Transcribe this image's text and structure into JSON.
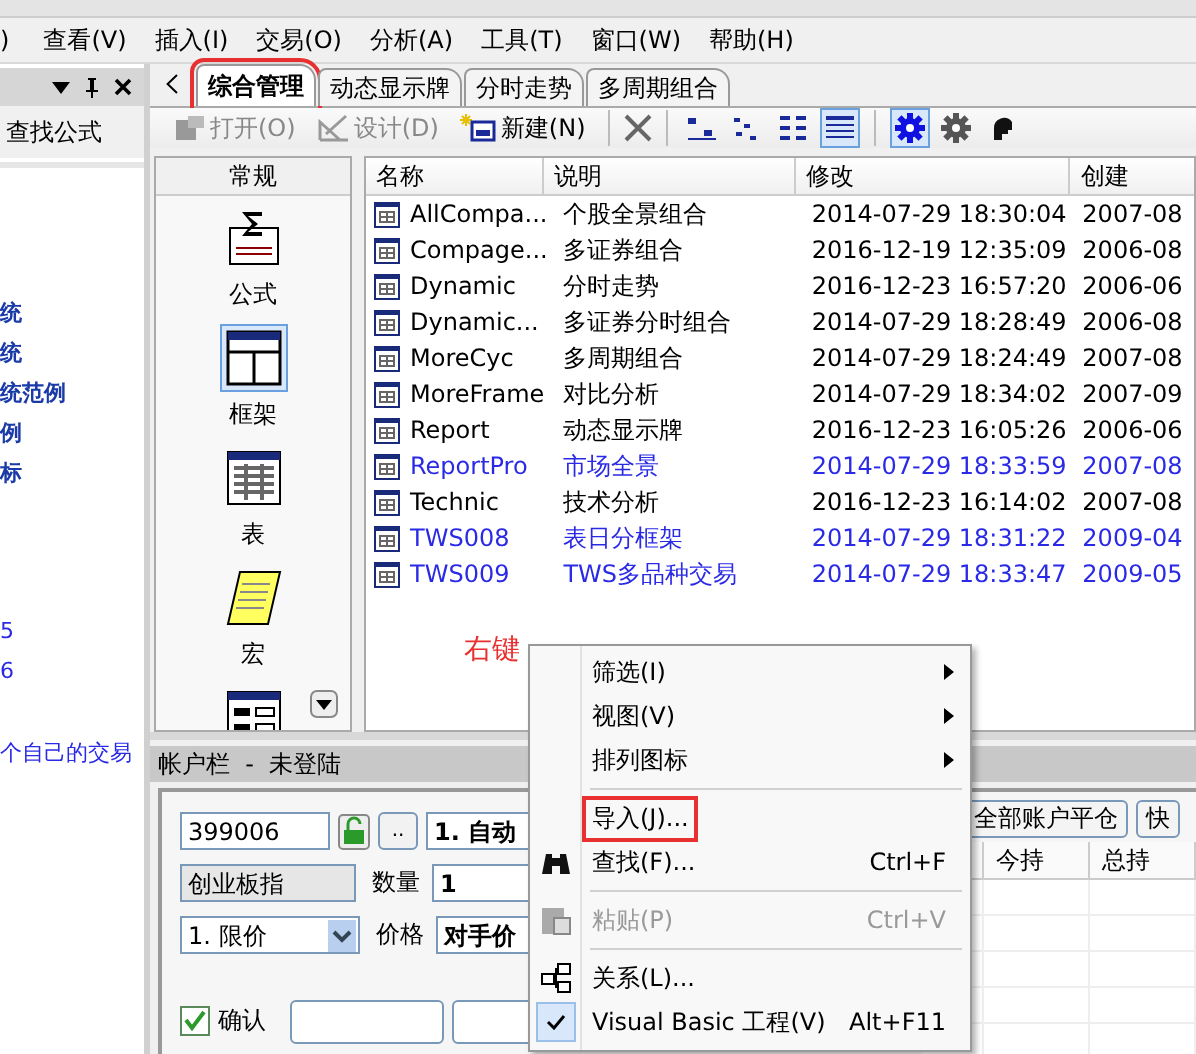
{
  "menu_bar": [
    {
      "label": ")"
    },
    {
      "label": "查看(V)"
    },
    {
      "label": "插入(I)"
    },
    {
      "label": "交易(O)"
    },
    {
      "label": "分析(A)"
    },
    {
      "label": "工具(T)"
    },
    {
      "label": "窗口(W)"
    },
    {
      "label": "帮助(H)"
    }
  ],
  "left_panel": {
    "search_label": "查找公式",
    "items": [
      "统",
      "统",
      "统范例",
      "例",
      "标",
      "5",
      "6",
      "个自己的交易"
    ]
  },
  "tabs": [
    {
      "label": "综合管理",
      "selected": true,
      "annotated": true
    },
    {
      "label": "动态显示牌",
      "selected": false,
      "annotated": false
    },
    {
      "label": "分时走势",
      "selected": false,
      "annotated": false
    },
    {
      "label": "多周期组合",
      "selected": false,
      "annotated": false
    }
  ],
  "toolbar": {
    "buttons": [
      {
        "label": "打开(O)",
        "disabled": true
      },
      {
        "label": "设计(D)",
        "disabled": true
      },
      {
        "label": "新建(N)",
        "disabled": false
      }
    ],
    "view_buttons": [
      {
        "selected": false
      },
      {
        "selected": false
      },
      {
        "selected": false
      },
      {
        "selected": true
      }
    ],
    "tool_buttons": [
      {
        "selected": true
      },
      {
        "selected": false
      },
      {
        "selected": false
      }
    ]
  },
  "categories": {
    "title": "常规",
    "items": [
      {
        "label": "公式",
        "selected": false
      },
      {
        "label": "框架",
        "selected": true
      },
      {
        "label": "表",
        "selected": false
      },
      {
        "label": "宏",
        "selected": false
      },
      {
        "selected": false
      }
    ]
  },
  "table": {
    "columns": [
      "名称",
      "说明",
      "修改",
      "创建"
    ],
    "rows": [
      {
        "name": "AllCompa...",
        "desc": "个股全景组合",
        "modified": "2014-07-29 18:30:04",
        "created": "2007-08",
        "color": "#000000"
      },
      {
        "name": "Compage...",
        "desc": "多证券组合",
        "modified": "2016-12-19 12:35:09",
        "created": "2006-08",
        "color": "#000000"
      },
      {
        "name": "Dynamic",
        "desc": "分时走势",
        "modified": "2016-12-23 16:57:20",
        "created": "2006-06",
        "color": "#000000"
      },
      {
        "name": "Dynamic...",
        "desc": "多证券分时组合",
        "modified": "2014-07-29 18:28:49",
        "created": "2006-08",
        "color": "#000000"
      },
      {
        "name": "MoreCyc",
        "desc": "多周期组合",
        "modified": "2014-07-29 18:24:49",
        "created": "2007-08",
        "color": "#000000"
      },
      {
        "name": "MoreFrame",
        "desc": "对比分析",
        "modified": "2014-07-29 18:34:02",
        "created": "2007-09",
        "color": "#000000"
      },
      {
        "name": "Report",
        "desc": "动态显示牌",
        "modified": "2016-12-23 16:05:26",
        "created": "2006-06",
        "color": "#000000"
      },
      {
        "name": "ReportPro",
        "desc": "市场全景",
        "modified": "2014-07-29 18:33:59",
        "created": "2007-08",
        "color": "#2a2ae6"
      },
      {
        "name": "Technic",
        "desc": "技术分析",
        "modified": "2016-12-23 16:14:02",
        "created": "2007-08",
        "color": "#000000"
      },
      {
        "name": "TWS008",
        "desc": "表日分框架",
        "modified": "2014-07-29 18:31:22",
        "created": "2009-04",
        "color": "#2a2ae6"
      },
      {
        "name": "TWS009",
        "desc": "TWS多品种交易",
        "modified": "2014-07-29 18:33:47",
        "created": "2009-05",
        "color": "#2a2ae6"
      }
    ]
  },
  "annotation": "右键",
  "account_panel": {
    "title": "帐户栏  -  未登陆",
    "code": "399006",
    "more": "..",
    "mode": "1. 自动",
    "instrument": "创业板指",
    "qty_label": "数量",
    "qty": "1",
    "order_type": "1. 限价",
    "price_label": "价格",
    "price": "对手价",
    "confirm": {
      "label": "确认",
      "checked": true
    },
    "buttons": [
      "全部账户平仓",
      "快"
    ],
    "columns": [
      "今持",
      "总持"
    ]
  },
  "context_menu": [
    {
      "kind": "item",
      "label": "筛选(I)",
      "submenu": true,
      "disabled": false,
      "checked": false,
      "annotated": false
    },
    {
      "kind": "item",
      "label": "视图(V)",
      "submenu": true,
      "disabled": false,
      "checked": false,
      "annotated": false
    },
    {
      "kind": "item",
      "label": "排列图标",
      "submenu": true,
      "disabled": false,
      "checked": false,
      "annotated": false
    },
    {
      "kind": "separator"
    },
    {
      "kind": "item",
      "label": "导入(J)...",
      "submenu": false,
      "disabled": false,
      "checked": false,
      "annotated": true
    },
    {
      "kind": "item",
      "label": "查找(F)...",
      "shortcut": "Ctrl+F",
      "submenu": false,
      "disabled": false,
      "checked": false,
      "annotated": false
    },
    {
      "kind": "separator"
    },
    {
      "kind": "item",
      "label": "粘贴(P)",
      "shortcut": "Ctrl+V",
      "submenu": false,
      "disabled": true,
      "checked": false,
      "annotated": false
    },
    {
      "kind": "separator"
    },
    {
      "kind": "item",
      "label": "关系(L)...",
      "submenu": false,
      "disabled": false,
      "checked": false,
      "annotated": false
    },
    {
      "kind": "item",
      "label": "Visual Basic 工程(V)",
      "shortcut": "Alt+F11",
      "submenu": false,
      "disabled": false,
      "checked": true,
      "annotated": false
    }
  ]
}
